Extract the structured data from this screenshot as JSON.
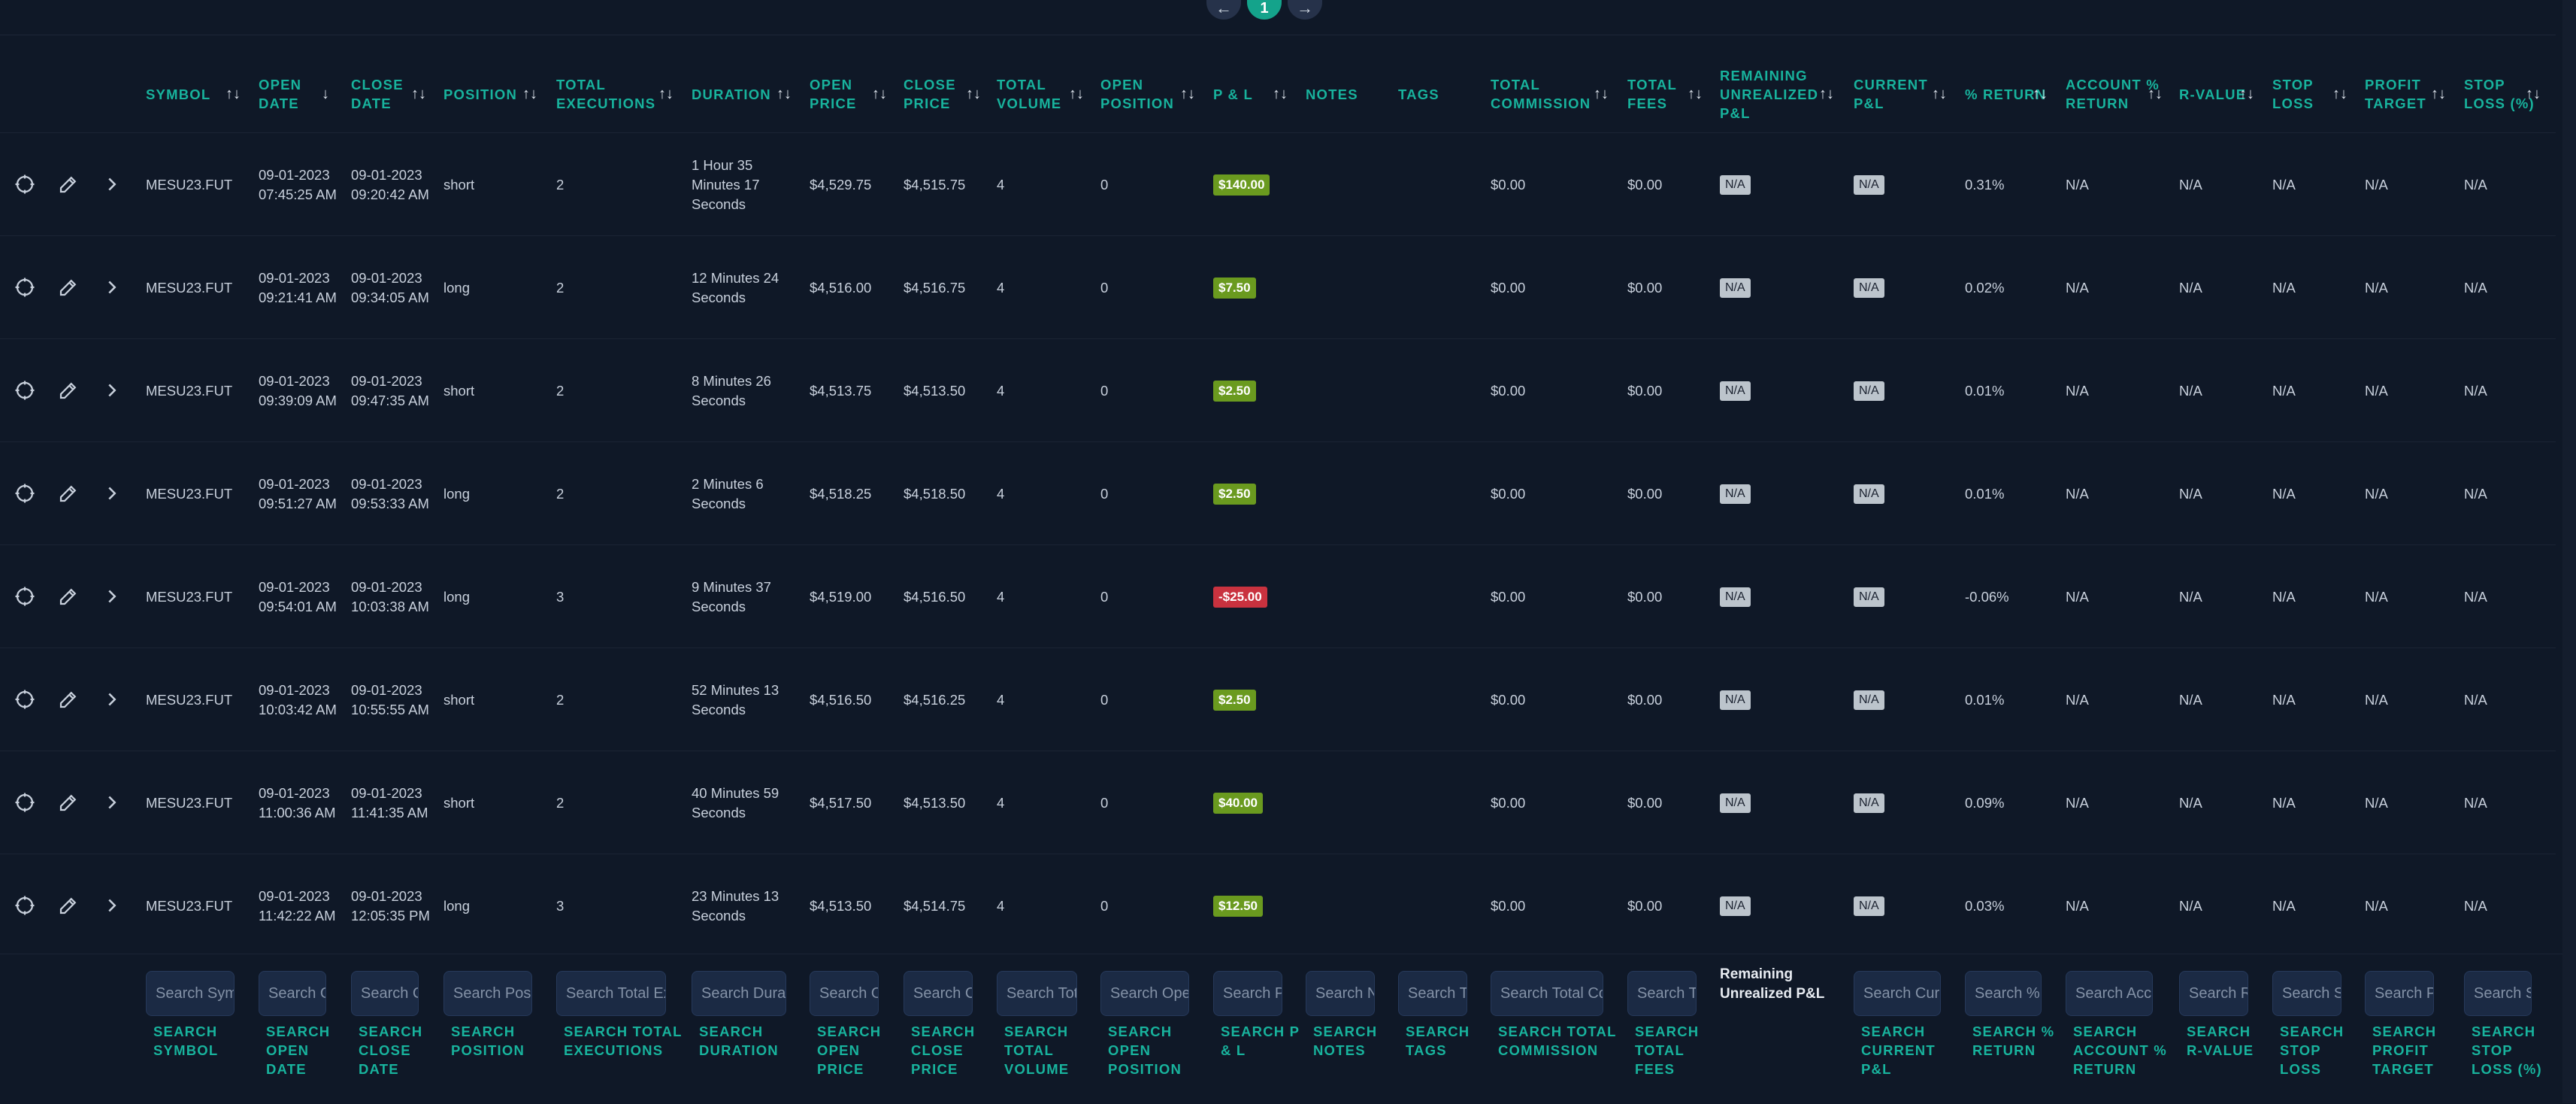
{
  "pagination": {
    "prev_icon": "arrow-left-icon",
    "current_page": "1",
    "next_icon": "arrow-right-icon"
  },
  "columns": [
    {
      "key": "symbol",
      "label": "SYMBOL",
      "sortable": true
    },
    {
      "key": "open_date",
      "label": "OPEN DATE",
      "sortable": true,
      "sort_state": "desc"
    },
    {
      "key": "close_date",
      "label": "CLOSE DATE",
      "sortable": true
    },
    {
      "key": "position",
      "label": "POSITION",
      "sortable": true
    },
    {
      "key": "total_executions",
      "label": "TOTAL EXECUTIONS",
      "sortable": true
    },
    {
      "key": "duration",
      "label": "DURATION",
      "sortable": true
    },
    {
      "key": "open_price",
      "label": "OPEN PRICE",
      "sortable": true
    },
    {
      "key": "close_price",
      "label": "CLOSE PRICE",
      "sortable": true
    },
    {
      "key": "total_volume",
      "label": "TOTAL VOLUME",
      "sortable": true
    },
    {
      "key": "open_position",
      "label": "OPEN POSITION",
      "sortable": true
    },
    {
      "key": "pnl",
      "label": "P & L",
      "sortable": true
    },
    {
      "key": "notes",
      "label": "NOTES",
      "sortable": false
    },
    {
      "key": "tags",
      "label": "TAGS",
      "sortable": false
    },
    {
      "key": "total_commission",
      "label": "TOTAL COMMISSION",
      "sortable": true
    },
    {
      "key": "total_fees",
      "label": "TOTAL FEES",
      "sortable": true
    },
    {
      "key": "remaining_unrealized_pnl",
      "label": "REMAINING UNREALIZED P&L",
      "sortable": true
    },
    {
      "key": "current_pnl",
      "label": "CURRENT P&L",
      "sortable": true
    },
    {
      "key": "pct_return",
      "label": "% RETURN",
      "sortable": true
    },
    {
      "key": "account_pct_return",
      "label": "ACCOUNT % RETURN",
      "sortable": true
    },
    {
      "key": "r_value",
      "label": "R-VALUE",
      "sortable": true
    },
    {
      "key": "stop_loss",
      "label": "STOP LOSS",
      "sortable": true
    },
    {
      "key": "profit_target",
      "label": "PROFIT TARGET",
      "sortable": true
    },
    {
      "key": "stop_loss_pct",
      "label": "STOP LOSS (%)",
      "sortable": true
    }
  ],
  "row_action_icons": [
    "crosshair-icon",
    "edit-pencil-icon",
    "chevron-right-icon"
  ],
  "rows": [
    {
      "symbol": "MESU23.FUT",
      "open_date": "09-01-2023 07:45:25 AM",
      "close_date": "09-01-2023 09:20:42 AM",
      "position": "short",
      "total_executions": "2",
      "duration": "1 Hour 35 Minutes 17 Seconds",
      "open_price": "$4,529.75",
      "close_price": "$4,515.75",
      "total_volume": "4",
      "open_position": "0",
      "pnl": "$140.00",
      "pnl_sign": "pos",
      "notes": "",
      "tags": "",
      "total_commission": "$0.00",
      "total_fees": "$0.00",
      "remaining_unrealized_pnl": "N/A",
      "current_pnl": "N/A",
      "pct_return": "0.31%",
      "account_pct_return": "N/A",
      "r_value": "N/A",
      "stop_loss": "N/A",
      "profit_target": "N/A",
      "stop_loss_pct": "N/A"
    },
    {
      "symbol": "MESU23.FUT",
      "open_date": "09-01-2023 09:21:41 AM",
      "close_date": "09-01-2023 09:34:05 AM",
      "position": "long",
      "total_executions": "2",
      "duration": "12 Minutes 24 Seconds",
      "open_price": "$4,516.00",
      "close_price": "$4,516.75",
      "total_volume": "4",
      "open_position": "0",
      "pnl": "$7.50",
      "pnl_sign": "pos",
      "notes": "",
      "tags": "",
      "total_commission": "$0.00",
      "total_fees": "$0.00",
      "remaining_unrealized_pnl": "N/A",
      "current_pnl": "N/A",
      "pct_return": "0.02%",
      "account_pct_return": "N/A",
      "r_value": "N/A",
      "stop_loss": "N/A",
      "profit_target": "N/A",
      "stop_loss_pct": "N/A"
    },
    {
      "symbol": "MESU23.FUT",
      "open_date": "09-01-2023 09:39:09 AM",
      "close_date": "09-01-2023 09:47:35 AM",
      "position": "short",
      "total_executions": "2",
      "duration": "8 Minutes 26 Seconds",
      "open_price": "$4,513.75",
      "close_price": "$4,513.50",
      "total_volume": "4",
      "open_position": "0",
      "pnl": "$2.50",
      "pnl_sign": "pos",
      "notes": "",
      "tags": "",
      "total_commission": "$0.00",
      "total_fees": "$0.00",
      "remaining_unrealized_pnl": "N/A",
      "current_pnl": "N/A",
      "pct_return": "0.01%",
      "account_pct_return": "N/A",
      "r_value": "N/A",
      "stop_loss": "N/A",
      "profit_target": "N/A",
      "stop_loss_pct": "N/A"
    },
    {
      "symbol": "MESU23.FUT",
      "open_date": "09-01-2023 09:51:27 AM",
      "close_date": "09-01-2023 09:53:33 AM",
      "position": "long",
      "total_executions": "2",
      "duration": "2 Minutes 6 Seconds",
      "open_price": "$4,518.25",
      "close_price": "$4,518.50",
      "total_volume": "4",
      "open_position": "0",
      "pnl": "$2.50",
      "pnl_sign": "pos",
      "notes": "",
      "tags": "",
      "total_commission": "$0.00",
      "total_fees": "$0.00",
      "remaining_unrealized_pnl": "N/A",
      "current_pnl": "N/A",
      "pct_return": "0.01%",
      "account_pct_return": "N/A",
      "r_value": "N/A",
      "stop_loss": "N/A",
      "profit_target": "N/A",
      "stop_loss_pct": "N/A"
    },
    {
      "symbol": "MESU23.FUT",
      "open_date": "09-01-2023 09:54:01 AM",
      "close_date": "09-01-2023 10:03:38 AM",
      "position": "long",
      "total_executions": "3",
      "duration": "9 Minutes 37 Seconds",
      "open_price": "$4,519.00",
      "close_price": "$4,516.50",
      "total_volume": "4",
      "open_position": "0",
      "pnl": "-$25.00",
      "pnl_sign": "neg",
      "notes": "",
      "tags": "",
      "total_commission": "$0.00",
      "total_fees": "$0.00",
      "remaining_unrealized_pnl": "N/A",
      "current_pnl": "N/A",
      "pct_return": "-0.06%",
      "account_pct_return": "N/A",
      "r_value": "N/A",
      "stop_loss": "N/A",
      "profit_target": "N/A",
      "stop_loss_pct": "N/A"
    },
    {
      "symbol": "MESU23.FUT",
      "open_date": "09-01-2023 10:03:42 AM",
      "close_date": "09-01-2023 10:55:55 AM",
      "position": "short",
      "total_executions": "2",
      "duration": "52 Minutes 13 Seconds",
      "open_price": "$4,516.50",
      "close_price": "$4,516.25",
      "total_volume": "4",
      "open_position": "0",
      "pnl": "$2.50",
      "pnl_sign": "pos",
      "notes": "",
      "tags": "",
      "total_commission": "$0.00",
      "total_fees": "$0.00",
      "remaining_unrealized_pnl": "N/A",
      "current_pnl": "N/A",
      "pct_return": "0.01%",
      "account_pct_return": "N/A",
      "r_value": "N/A",
      "stop_loss": "N/A",
      "profit_target": "N/A",
      "stop_loss_pct": "N/A"
    },
    {
      "symbol": "MESU23.FUT",
      "open_date": "09-01-2023 11:00:36 AM",
      "close_date": "09-01-2023 11:41:35 AM",
      "position": "short",
      "total_executions": "2",
      "duration": "40 Minutes 59 Seconds",
      "open_price": "$4,517.50",
      "close_price": "$4,513.50",
      "total_volume": "4",
      "open_position": "0",
      "pnl": "$40.00",
      "pnl_sign": "pos",
      "notes": "",
      "tags": "",
      "total_commission": "$0.00",
      "total_fees": "$0.00",
      "remaining_unrealized_pnl": "N/A",
      "current_pnl": "N/A",
      "pct_return": "0.09%",
      "account_pct_return": "N/A",
      "r_value": "N/A",
      "stop_loss": "N/A",
      "profit_target": "N/A",
      "stop_loss_pct": "N/A"
    },
    {
      "symbol": "MESU23.FUT",
      "open_date": "09-01-2023 11:42:22 AM",
      "close_date": "09-01-2023 12:05:35 PM",
      "position": "long",
      "total_executions": "3",
      "duration": "23 Minutes 13 Seconds",
      "open_price": "$4,513.50",
      "close_price": "$4,514.75",
      "total_volume": "4",
      "open_position": "0",
      "pnl": "$12.50",
      "pnl_sign": "pos",
      "notes": "",
      "tags": "",
      "total_commission": "$0.00",
      "total_fees": "$0.00",
      "remaining_unrealized_pnl": "N/A",
      "current_pnl": "N/A",
      "pct_return": "0.03%",
      "account_pct_return": "N/A",
      "r_value": "N/A",
      "stop_loss": "N/A",
      "profit_target": "N/A",
      "stop_loss_pct": "N/A"
    }
  ],
  "search_row": [
    {
      "key": "symbol",
      "placeholder": "Search Symbol",
      "label": "SEARCH SYMBOL"
    },
    {
      "key": "open_date",
      "placeholder": "Search Open Date",
      "label": "SEARCH OPEN DATE"
    },
    {
      "key": "close_date",
      "placeholder": "Search Close Date",
      "label": "SEARCH CLOSE DATE"
    },
    {
      "key": "position",
      "placeholder": "Search Position",
      "label": "SEARCH POSITION"
    },
    {
      "key": "total_executions",
      "placeholder": "Search Total Executions",
      "label": "SEARCH TOTAL EXECUTIONS"
    },
    {
      "key": "duration",
      "placeholder": "Search Duration",
      "label": "SEARCH DURATION"
    },
    {
      "key": "open_price",
      "placeholder": "Search Open Price",
      "label": "SEARCH OPEN PRICE"
    },
    {
      "key": "close_price",
      "placeholder": "Search Close Price",
      "label": "SEARCH CLOSE PRICE"
    },
    {
      "key": "total_volume",
      "placeholder": "Search Total Volume",
      "label": "SEARCH TOTAL VOLUME"
    },
    {
      "key": "open_position",
      "placeholder": "Search Open Position",
      "label": "SEARCH OPEN POSITION"
    },
    {
      "key": "pnl",
      "placeholder": "Search P & L",
      "label": "SEARCH P & L"
    },
    {
      "key": "notes",
      "placeholder": "Search Notes",
      "label": "SEARCH NOTES"
    },
    {
      "key": "tags",
      "placeholder": "Search Tags",
      "label": "SEARCH TAGS"
    },
    {
      "key": "total_commission",
      "placeholder": "Search Total Commission",
      "label": "SEARCH TOTAL COMMISSION"
    },
    {
      "key": "total_fees",
      "placeholder": "Search Total Fees",
      "label": "SEARCH TOTAL FEES"
    },
    {
      "key": "remaining_unrealized_pnl",
      "static_text": "Remaining Unrealized P&L"
    },
    {
      "key": "current_pnl",
      "placeholder": "Search Current P&L",
      "label": "SEARCH CURRENT P&L"
    },
    {
      "key": "pct_return",
      "placeholder": "Search % Return",
      "label": "SEARCH % RETURN"
    },
    {
      "key": "account_pct_return",
      "placeholder": "Search Account % Return",
      "label": "SEARCH ACCOUNT % RETURN"
    },
    {
      "key": "r_value",
      "placeholder": "Search R-Value",
      "label": "SEARCH R-VALUE"
    },
    {
      "key": "stop_loss",
      "placeholder": "Search Stop Loss",
      "label": "SEARCH STOP LOSS"
    },
    {
      "key": "profit_target",
      "placeholder": "Search Profit Target",
      "label": "SEARCH PROFIT TARGET"
    },
    {
      "key": "stop_loss_pct",
      "placeholder": "Search Stop Loss (%)",
      "label": "SEARCH STOP LOSS (%)"
    }
  ],
  "colors": {
    "background": "#0f1827",
    "accent": "#18b39d",
    "pnl_positive": "#6a9a1f",
    "pnl_negative": "#c9323f",
    "badge_na": "#bcc4cc"
  }
}
